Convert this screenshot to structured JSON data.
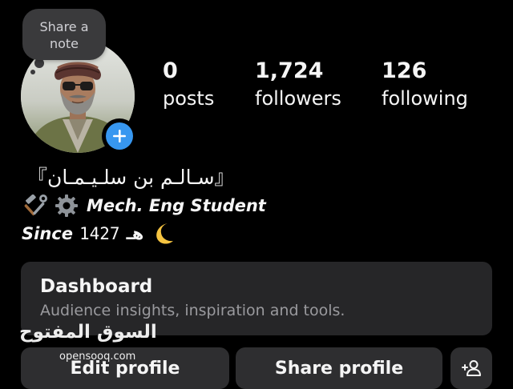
{
  "note": {
    "label_line1": "Share a",
    "label_line2": "note"
  },
  "stats": [
    {
      "value": "0",
      "label": "posts"
    },
    {
      "value": "1,724",
      "label": "followers"
    },
    {
      "value": "126",
      "label": "following"
    }
  ],
  "bio": {
    "name": "『سـالـم بن سلـيـمـان』",
    "line2_icons": [
      "hammer-and-wrench-icon",
      "gear-icon"
    ],
    "line2_text": "Mech. Eng Student",
    "since": "Since",
    "year": "1427",
    "hijri_suffix": "هـ",
    "line3_icon": "crescent-moon-icon"
  },
  "dashboard": {
    "title": "Dashboard",
    "subtitle": "Audience insights, inspiration and tools."
  },
  "buttons": {
    "edit_profile": "Edit profile",
    "share_profile": "Share profile",
    "add_person_icon": "add-person-icon"
  },
  "watermark": {
    "arabic": "السوق المفتوح",
    "latin": "opensooq.com"
  },
  "colors": {
    "background": "#000000",
    "card": "#262628",
    "button": "#2e2e30",
    "accent_blue": "#3797f0",
    "note_bubble": "#3a3a3c",
    "moon_yellow": "#f6c441"
  }
}
